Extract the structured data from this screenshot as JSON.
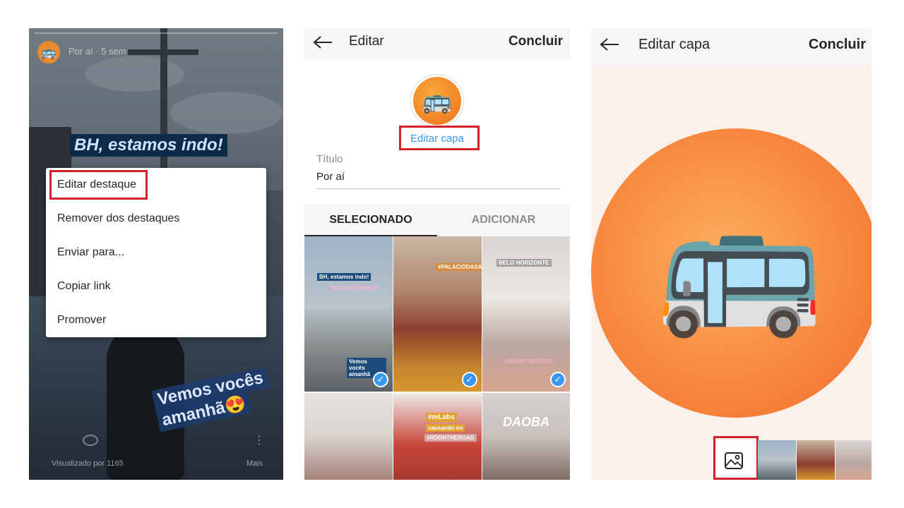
{
  "panel1": {
    "time": "Por aí · 5 sem",
    "sticker_top": "BH, estamos indo!",
    "sticker_bottom_line1": "Vemos vocês",
    "sticker_bottom_line2": "amanhã😍",
    "views": "Visualizado por 1165",
    "more": "Mais",
    "avatar_emoji": "🚌",
    "menu_items": [
      "Editar destaque",
      "Remover dos destaques",
      "Enviar para...",
      "Copiar link",
      "Promover"
    ]
  },
  "panel2": {
    "title": "Editar",
    "done": "Concluir",
    "cover_emoji": "🚌",
    "edit_cover": "Editar capa",
    "field_label": "Título",
    "field_value": "Por aí",
    "tab_selected": "SELECIONADO",
    "tab_add": "ADICIONAR",
    "grid_texts": [
      "BH, estamos indo!",
      "#RDONTHEROAD",
      "Vemos vocês amanhã",
      "#PALACIODASARTES",
      "BELO HORIZONTE",
      "#RDONTHEROAD",
      "#mLabs",
      "causando no",
      "#RDONTHEROAD",
      "DAOBA"
    ],
    "check": "✓"
  },
  "panel3": {
    "title": "Editar capa",
    "done": "Concluir",
    "cover_emoji": "🚌"
  },
  "colors": {
    "highlight_red": "#d3202a",
    "link_blue": "#3897f0",
    "orange": "#f8893f"
  }
}
